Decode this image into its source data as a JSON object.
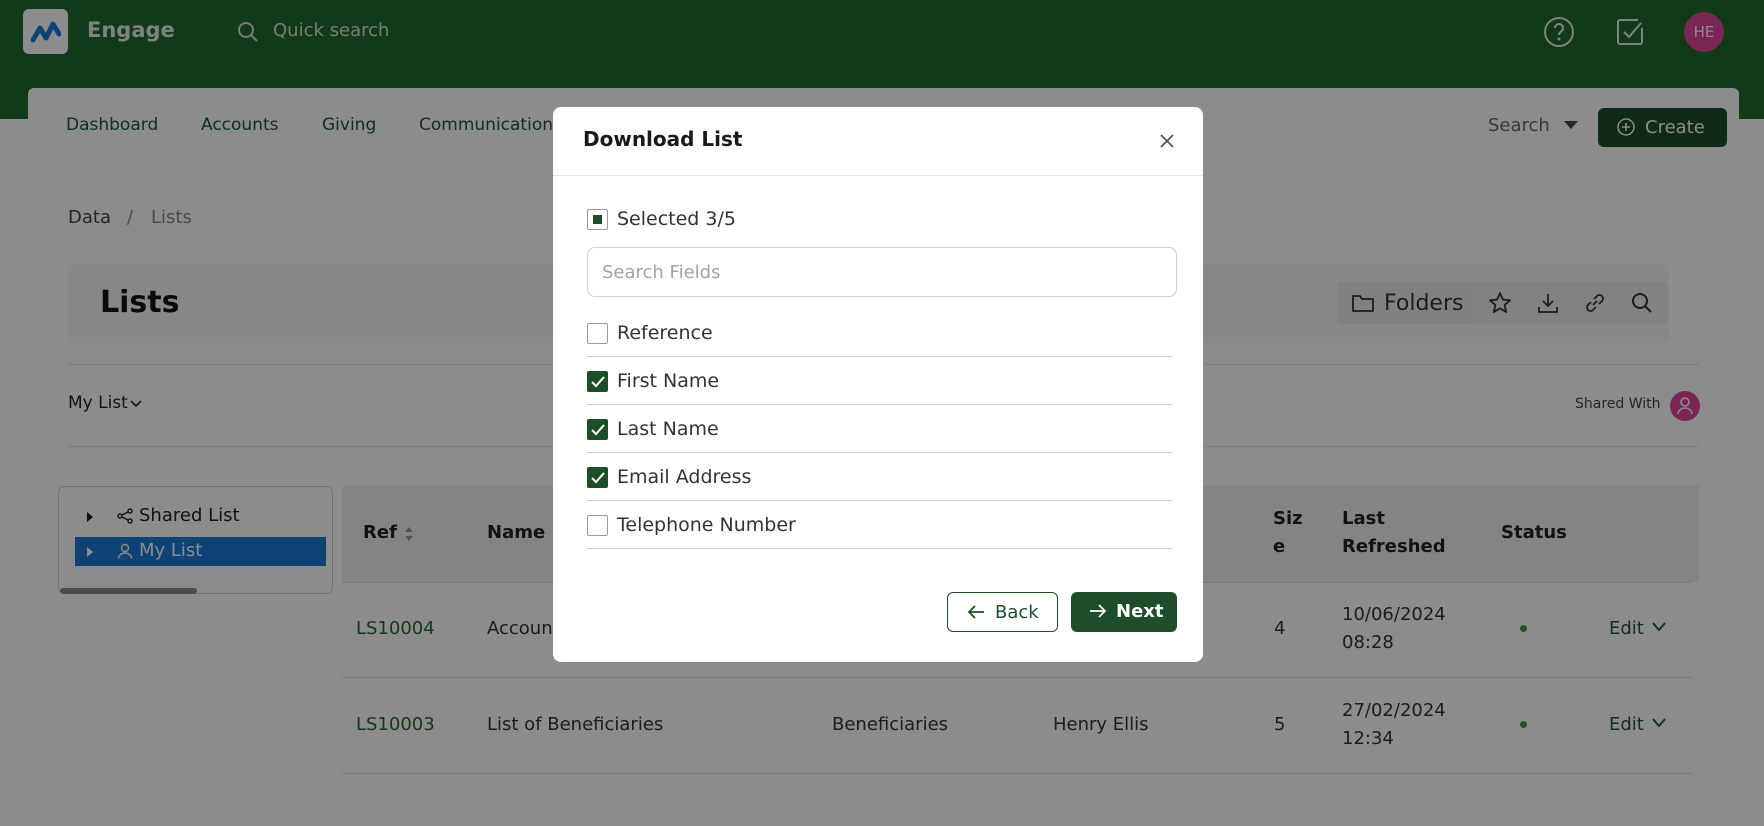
{
  "app": {
    "name": "Engage",
    "quick_search_placeholder": "Quick search",
    "avatar_initials": "HE"
  },
  "nav": {
    "items": [
      "Dashboard",
      "Accounts",
      "Giving",
      "Communications"
    ],
    "search_label": "Search",
    "create_label": "Create"
  },
  "breadcrumb": {
    "root": "Data",
    "separator": "/",
    "current": "Lists"
  },
  "page": {
    "title": "Lists",
    "folders_label": "Folders"
  },
  "list_selector": {
    "label": "My List",
    "shared_with_label": "Shared With"
  },
  "tree": {
    "items": [
      {
        "label": "Shared List",
        "selected": false
      },
      {
        "label": "My List",
        "selected": true
      }
    ]
  },
  "table": {
    "headers": {
      "ref": "Ref",
      "name": "Name",
      "size_a": "Siz",
      "size_b": "e",
      "refreshed_a": "Last",
      "refreshed_b": "Refreshed",
      "status": "Status"
    },
    "rows": [
      {
        "ref": "LS10004",
        "name": "Accoun",
        "type": "",
        "owner": "",
        "size": "4",
        "date": "10/06/2024",
        "time": "08:28",
        "action": "Edit"
      },
      {
        "ref": "LS10003",
        "name": "List of Beneficiaries",
        "type": "Beneficiaries",
        "owner": "Henry Ellis",
        "size": "5",
        "date": "27/02/2024",
        "time": "12:34",
        "action": "Edit"
      }
    ]
  },
  "modal": {
    "title": "Download List",
    "selected_label": "Selected 3/5",
    "search_placeholder": "Search Fields",
    "fields": [
      {
        "label": "Reference",
        "checked": false
      },
      {
        "label": "First Name",
        "checked": true
      },
      {
        "label": "Last Name",
        "checked": true
      },
      {
        "label": "Email Address",
        "checked": true
      },
      {
        "label": "Telephone Number",
        "checked": false
      }
    ],
    "back_label": "Back",
    "next_label": "Next"
  },
  "colors": {
    "brand": "#1f6b2e",
    "primary_button": "#1d4e29",
    "avatar": "#e0449a",
    "selection": "#1e7bd6",
    "status_active": "#2e9e38"
  }
}
